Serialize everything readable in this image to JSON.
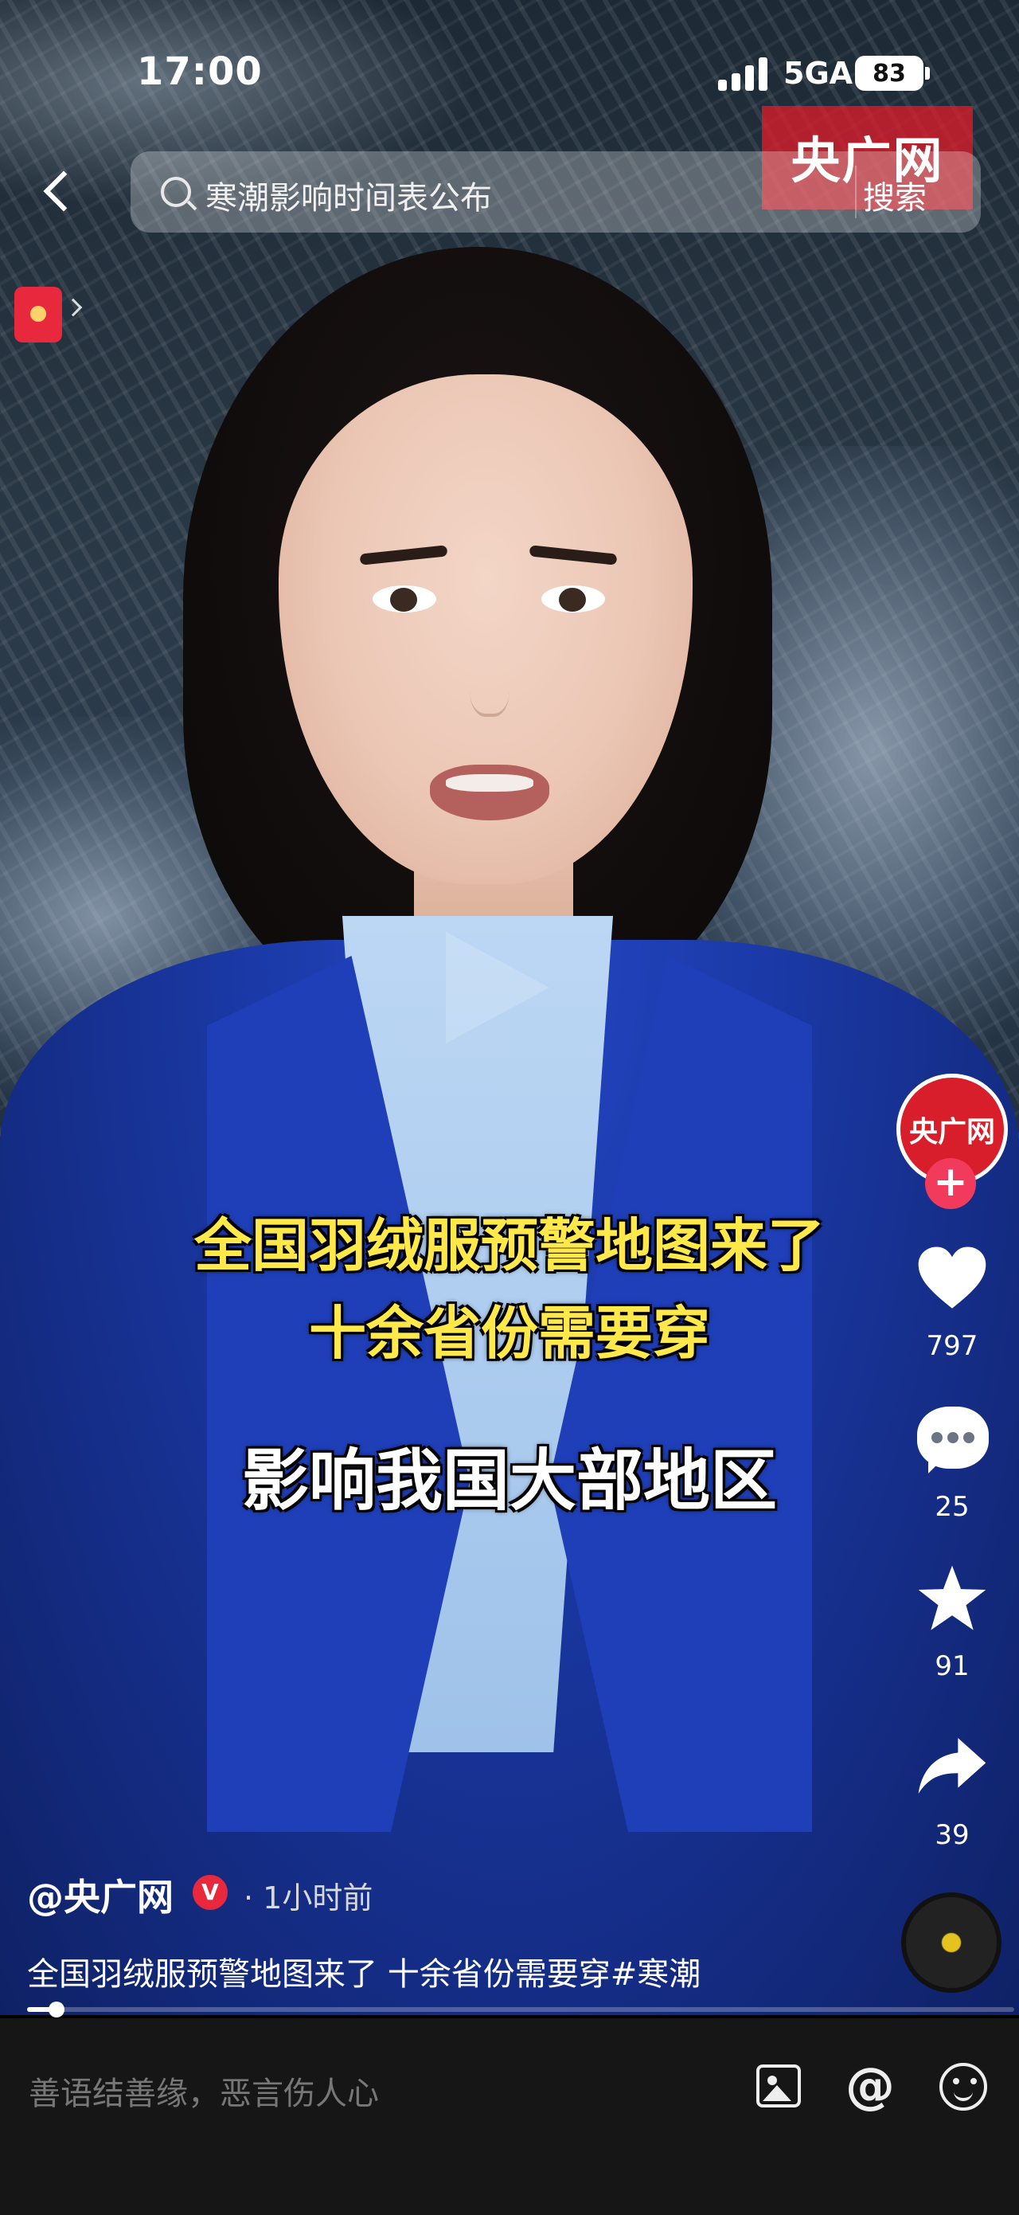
{
  "status_bar": {
    "time": "17:00",
    "network": "5GA",
    "battery": "83"
  },
  "search": {
    "query": "寒潮影响时间表公布",
    "button_label": "搜索"
  },
  "watermark": "央广网",
  "subtitles": {
    "line1": "全国羽绒服预警地图来了",
    "line2": "十余省份需要穿",
    "line3": "影响我国大部地区"
  },
  "actions": {
    "avatar_label": "央广网",
    "likes": "797",
    "comments": "25",
    "favorites": "91",
    "shares": "39"
  },
  "video_info": {
    "author": "@央广网",
    "verified_badge": "V",
    "time": "· 1小时前",
    "description": "全国羽绒服预警地图来了 十余省份需要穿#寒潮",
    "progress": 0.03
  },
  "comment_bar": {
    "placeholder": "善语结善缘，恶言伤人心"
  },
  "colors": {
    "accent": "#f23b5c",
    "brand_red": "#d81e2a",
    "subtitle_yellow": "#ffe94a"
  },
  "icons": [
    "back-icon",
    "search-icon",
    "red-packet-icon",
    "heart-icon",
    "comment-icon",
    "star-icon",
    "share-icon",
    "music-disc-icon",
    "image-icon",
    "at-icon",
    "emoji-icon",
    "play-icon"
  ]
}
